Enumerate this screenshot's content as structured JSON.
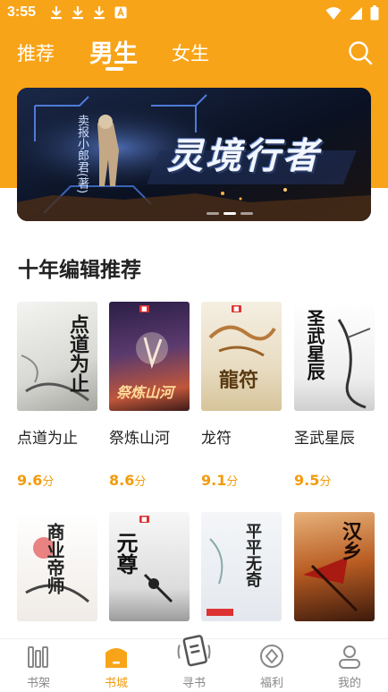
{
  "status_bar": {
    "time": "3:55"
  },
  "top_nav": {
    "tabs": [
      {
        "label": "推荐"
      },
      {
        "label": "男生"
      },
      {
        "label": "女生"
      }
    ],
    "active_tab": "男生"
  },
  "banner": {
    "title": "灵境行者",
    "author": "卖报小郎君(著)"
  },
  "section": {
    "title": "十年编辑推荐"
  },
  "books": [
    {
      "name": "点道为止",
      "score": "9.6",
      "unit": "分",
      "cover_text": "点道为止"
    },
    {
      "name": "祭炼山河",
      "score": "8.6",
      "unit": "分",
      "cover_text": "祭炼山河"
    },
    {
      "name": "龙符",
      "score": "9.1",
      "unit": "分",
      "cover_text": "龍符"
    },
    {
      "name": "圣武星辰",
      "score": "9.5",
      "unit": "分",
      "cover_text": "圣武星辰"
    }
  ],
  "books_row2": [
    {
      "cover_text": "商业帝师"
    },
    {
      "cover_text": "元尊"
    },
    {
      "cover_text": "平平无奇"
    },
    {
      "cover_text": "汉乡"
    }
  ],
  "bottom_nav": {
    "items": [
      {
        "label": "书架",
        "icon": "bookshelf-icon"
      },
      {
        "label": "书城",
        "icon": "bookstore-icon"
      },
      {
        "label": "寻书",
        "icon": "find-book-icon"
      },
      {
        "label": "福利",
        "icon": "welfare-icon"
      },
      {
        "label": "我的",
        "icon": "profile-icon"
      }
    ],
    "active": "书城"
  },
  "colors": {
    "accent": "#f8a418",
    "score": "#f29b0c"
  }
}
